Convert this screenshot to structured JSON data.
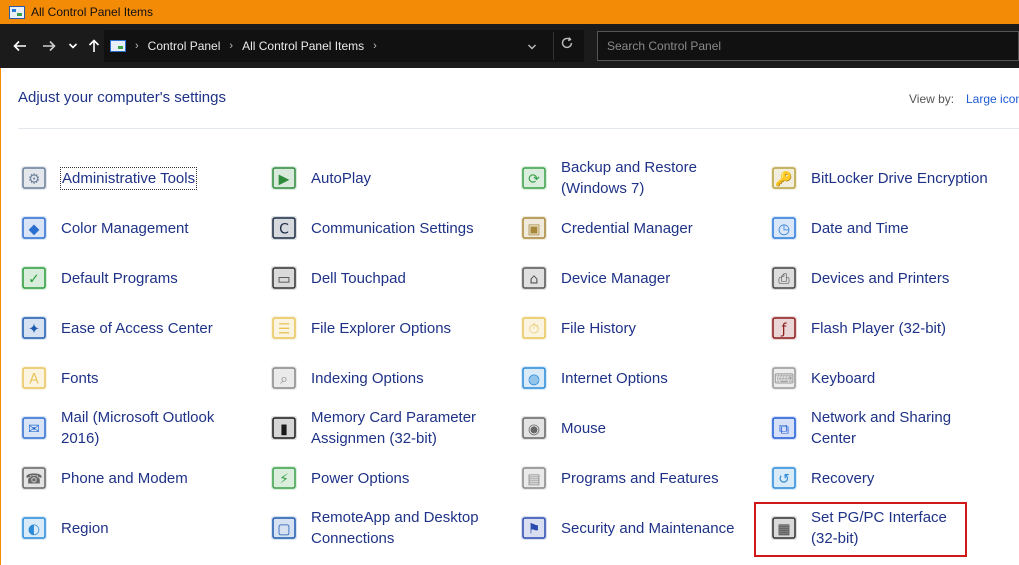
{
  "window": {
    "title": "All Control Panel Items"
  },
  "navbar": {
    "breadcrumbs": [
      "Control Panel",
      "All Control Panel Items"
    ],
    "search_placeholder": "Search Control Panel"
  },
  "header": {
    "title": "Adjust your computer's settings",
    "view_by_label": "View by:",
    "view_by_value": "Large icons"
  },
  "items": [
    {
      "label": "Administrative Tools",
      "icon": "admin-tools-icon",
      "color": "#6a7f99"
    },
    {
      "label": "AutoPlay",
      "icon": "autoplay-icon",
      "color": "#2e8b3c"
    },
    {
      "label": "Backup and Restore\n(Windows 7)",
      "icon": "backup-restore-icon",
      "color": "#3aa04a"
    },
    {
      "label": "BitLocker Drive Encryption",
      "icon": "bitlocker-icon",
      "color": "#b8a040"
    },
    {
      "label": "Color Management",
      "icon": "color-management-icon",
      "color": "#2a6fd0"
    },
    {
      "label": "Communication Settings",
      "icon": "communication-settings-icon",
      "color": "#1c2a44"
    },
    {
      "label": "Credential Manager",
      "icon": "credential-manager-icon",
      "color": "#a8883a"
    },
    {
      "label": "Date and Time",
      "icon": "date-time-icon",
      "color": "#2a7ad8"
    },
    {
      "label": "Default Programs",
      "icon": "default-programs-icon",
      "color": "#2a9d3c"
    },
    {
      "label": "Dell Touchpad",
      "icon": "touchpad-icon",
      "color": "#333333"
    },
    {
      "label": "Device Manager",
      "icon": "device-manager-icon",
      "color": "#555555"
    },
    {
      "label": "Devices and Printers",
      "icon": "devices-printers-icon",
      "color": "#444444"
    },
    {
      "label": "Ease of Access Center",
      "icon": "ease-of-access-icon",
      "color": "#1e5bb0"
    },
    {
      "label": "File Explorer Options",
      "icon": "file-explorer-options-icon",
      "color": "#e8c35a"
    },
    {
      "label": "File History",
      "icon": "file-history-icon",
      "color": "#e8c35a"
    },
    {
      "label": "Flash Player (32-bit)",
      "icon": "flash-player-icon",
      "color": "#8b1a1a"
    },
    {
      "label": "Fonts",
      "icon": "fonts-icon",
      "color": "#e8c35a"
    },
    {
      "label": "Indexing Options",
      "icon": "indexing-options-icon",
      "color": "#888888"
    },
    {
      "label": "Internet Options",
      "icon": "internet-options-icon",
      "color": "#2a8ad8"
    },
    {
      "label": "Keyboard",
      "icon": "keyboard-icon",
      "color": "#999999"
    },
    {
      "label": "Mail (Microsoft Outlook\n2016)",
      "icon": "mail-icon",
      "color": "#2a6fd0"
    },
    {
      "label": "Memory Card Parameter\nAssignmen (32-bit)",
      "icon": "memory-card-icon",
      "color": "#1a1a1a"
    },
    {
      "label": "Mouse",
      "icon": "mouse-icon",
      "color": "#666666"
    },
    {
      "label": "Network and Sharing\nCenter",
      "icon": "network-sharing-icon",
      "color": "#1e5bd6"
    },
    {
      "label": "Phone and Modem",
      "icon": "phone-modem-icon",
      "color": "#666666"
    },
    {
      "label": "Power Options",
      "icon": "power-options-icon",
      "color": "#3aa04a"
    },
    {
      "label": "Programs and Features",
      "icon": "programs-features-icon",
      "color": "#888888"
    },
    {
      "label": "Recovery",
      "icon": "recovery-icon",
      "color": "#2a8ad8"
    },
    {
      "label": "Region",
      "icon": "region-icon",
      "color": "#2a8ad8"
    },
    {
      "label": "RemoteApp and Desktop\nConnections",
      "icon": "remoteapp-icon",
      "color": "#1e5bb0"
    },
    {
      "label": "Security and Maintenance",
      "icon": "security-maintenance-icon",
      "color": "#2a4ab0"
    },
    {
      "label": "Set PG/PC Interface\n(32-bit)",
      "icon": "set-pg-pc-interface-icon",
      "color": "#333333"
    }
  ]
}
